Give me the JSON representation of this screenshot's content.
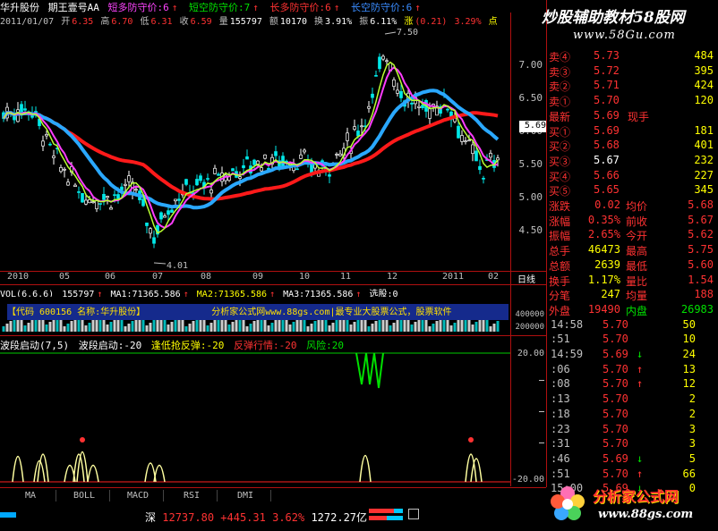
{
  "title_bar": {
    "stock_name": "华升股份",
    "period": "期王壹号AA",
    "indicators": [
      {
        "label": "短多防守价:6",
        "color": "#ff44ff",
        "arrow": "↑"
      },
      {
        "label": "短空防守价:7",
        "color": "#00e000",
        "arrow": "↑"
      },
      {
        "label": "长多防守价:6",
        "color": "#ff3232",
        "arrow": "↑"
      },
      {
        "label": "长空防守价:6",
        "color": "#3a8cff",
        "arrow": "↑"
      }
    ]
  },
  "ohlc": {
    "date": "2011/01/07",
    "open_label": "开",
    "open": "6.35",
    "high_label": "高",
    "high": "6.70",
    "low_label": "低",
    "low": "6.31",
    "close_label": "收",
    "close": "6.59",
    "vol_label": "量",
    "vol": "155797",
    "amount_label": "额",
    "amount": "10170",
    "turnover_label": "换",
    "turnover": "3.91%",
    "amplitude_label": "振",
    "amplitude": "6.11%",
    "change_label": "涨",
    "change": "(0.21)",
    "change_pct": "3.29%",
    "tail": "点"
  },
  "price_scale": [
    "7.00",
    "6.50",
    "6.00",
    "5.50",
    "5.00",
    "4.50"
  ],
  "current_price_tag": "5.69",
  "high_marker": "7.50",
  "low_marker": "4.01",
  "time_axis": {
    "labels": [
      "2010",
      "05",
      "06",
      "07",
      "08",
      "09",
      "10",
      "11",
      "12",
      "2011",
      "02"
    ],
    "period_label": "日线"
  },
  "volume_header": {
    "name": "VOL(6,6,6)",
    "vol": "155797",
    "ma1": "MA1:71365.586",
    "ma2": "MA2:71365.586",
    "ma3": "MA3:71365.586",
    "extra": "选股:0"
  },
  "volume_banner": "【代码 600156 名称:华升股份】",
  "volume_banner_wm": "分析家公式网www.88gs.com",
  "volume_banner_right": "|最专业大股票公式，股票软件",
  "volume_scale": [
    "400000",
    "200000"
  ],
  "indicator_header": {
    "name": "波段启动(7,5)",
    "v1": "波段启动:-20",
    "v2": "逢低抢反弹:-20",
    "v3": "反弹行情:-20",
    "v4": "风险:20"
  },
  "indicator_scale": [
    "20.00",
    "-20.00"
  ],
  "tabs": [
    "MA",
    "BOLL",
    "MACD",
    "RSI",
    "DMI"
  ],
  "status_bar": {
    "market": "深",
    "index": "12737.80",
    "change": "+445.31",
    "pct": "3.62%",
    "amount": "1272.27亿"
  },
  "brand_top": {
    "logo": "炒股辅助教材58股网",
    "url": "www.58Gu.com"
  },
  "brand_bottom": {
    "logo": "分析家公式网",
    "url": "www.88gs.com"
  },
  "order_book": {
    "asks": [
      {
        "label": "卖④",
        "price": "5.73",
        "vol": "484"
      },
      {
        "label": "卖③",
        "price": "5.72",
        "vol": "395"
      },
      {
        "label": "卖②",
        "price": "5.71",
        "vol": "424"
      },
      {
        "label": "卖①",
        "price": "5.70",
        "vol": "120"
      }
    ],
    "latest": {
      "label": "最新",
      "price": "5.69",
      "tag": "现手"
    },
    "bids": [
      {
        "label": "买①",
        "price": "5.69",
        "vol": "181"
      },
      {
        "label": "买②",
        "price": "5.68",
        "vol": "401"
      },
      {
        "label": "买③",
        "price": "5.67",
        "vol": "232"
      },
      {
        "label": "买④",
        "price": "5.66",
        "vol": "227"
      },
      {
        "label": "买⑤",
        "price": "5.65",
        "vol": "345"
      }
    ],
    "stats": [
      {
        "k1": "涨跌",
        "v1": "0.02",
        "k2": "均价",
        "v2": "5.68"
      },
      {
        "k1": "涨幅",
        "v1": "0.35%",
        "k2": "前收",
        "v2": "5.67"
      },
      {
        "k1": "振幅",
        "v1": "2.65%",
        "k2": "今开",
        "v2": "5.62"
      },
      {
        "k1": "总手",
        "v1": "46473",
        "k2": "最高",
        "v2": "5.75"
      },
      {
        "k1": "总额",
        "v1": "2639",
        "k2": "最低",
        "v2": "5.60"
      },
      {
        "k1": "换手",
        "v1": "1.17%",
        "k2": "量比",
        "v2": "1.54"
      },
      {
        "k1": "分笔",
        "v1": "247",
        "k2": "均量",
        "v2": "188"
      }
    ],
    "outer": {
      "k1": "外盘",
      "v1": "19490",
      "k2": "内盘",
      "v2": "26983"
    },
    "ticks": [
      {
        "t": "14:58",
        "p": "5.70",
        "a": "",
        "v": "50"
      },
      {
        "t": ":51",
        "p": "5.70",
        "a": "",
        "v": "10"
      },
      {
        "t": "14:59",
        "p": "5.69",
        "a": "↓",
        "v": "24"
      },
      {
        "t": ":06",
        "p": "5.70",
        "a": "↑",
        "v": "13"
      },
      {
        "t": ":08",
        "p": "5.70",
        "a": "↑",
        "v": "12"
      },
      {
        "t": ":13",
        "p": "5.70",
        "a": "",
        "v": "2"
      },
      {
        "t": ":18",
        "p": "5.70",
        "a": "",
        "v": "2"
      },
      {
        "t": ":23",
        "p": "5.70",
        "a": "",
        "v": "3"
      },
      {
        "t": ":31",
        "p": "5.70",
        "a": "",
        "v": "3"
      },
      {
        "t": ":46",
        "p": "5.69",
        "a": "↓",
        "v": "5"
      },
      {
        "t": ":51",
        "p": "5.70",
        "a": "↑",
        "v": "66"
      },
      {
        "t": "15:00",
        "p": "5.69",
        "a": "↓",
        "v": "0"
      }
    ]
  },
  "colors": {
    "up": "#ff3232",
    "down": "#00e000",
    "grid": "#b01010",
    "ma_long": "#ff1a1a",
    "ma_mid": "#2aa8ff"
  }
}
